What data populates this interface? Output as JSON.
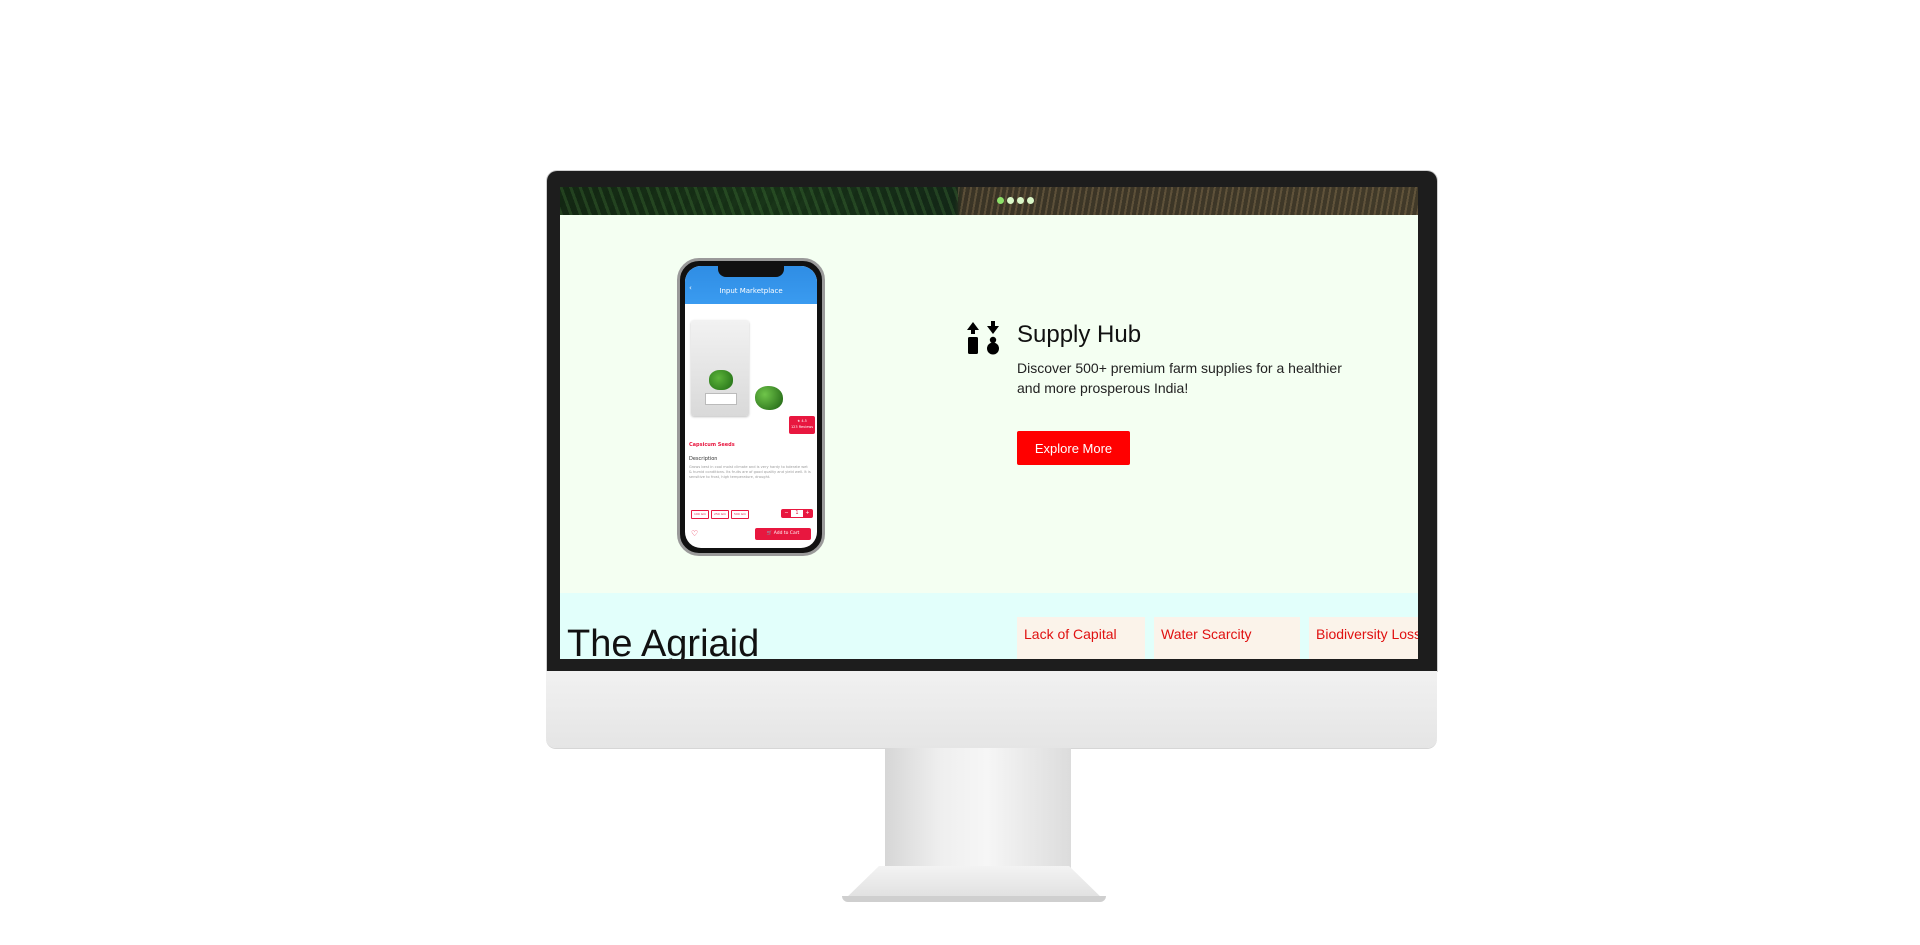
{
  "banner": {
    "slide_count": 4,
    "active_slide": 1
  },
  "phone": {
    "header_title": "Input Marketplace",
    "product_name": "Capsicum Seeds",
    "description_title": "Description",
    "description_text": "Grows best in cool moist climate and is very hardy to tolerate wet & humid conditions. Its fruits are of good quality and yield well. It is sensitive to frost, high temperature, drought.",
    "rating": "★ 4.5",
    "rating_sub": "123 Reviews",
    "pack_sizes": [
      "100 Gm",
      "250 Gm",
      "500 Gm"
    ],
    "quantity": "1",
    "add_to_cart": "Add to Cart"
  },
  "hub": {
    "title": "Supply Hub",
    "description": "Discover 500+ premium farm supplies for a healthier and more prosperous India!",
    "cta_label": "Explore More"
  },
  "agriaid": {
    "heading": "The Agriaid",
    "problems": [
      "Lack of Capital",
      "Water Scarcity",
      "Biodiversity Loss"
    ]
  },
  "colors": {
    "accent": "#ff0000",
    "app_accent": "#e8173f",
    "app_header": "#3a9bf0",
    "hub_background": "#f4fff2",
    "band_background": "#e2fffb",
    "card_background": "#fbf3ea",
    "monitor_bezel": "#1d1d1d"
  }
}
